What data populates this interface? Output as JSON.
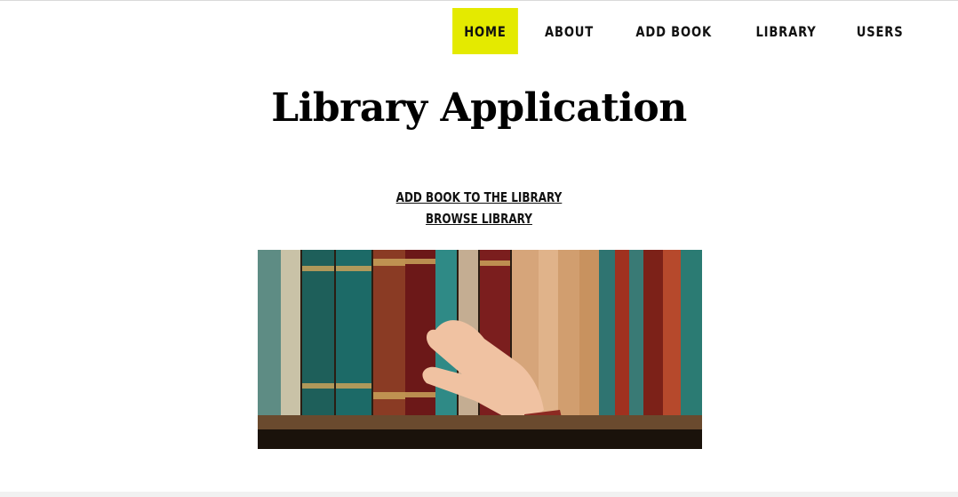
{
  "nav": {
    "items": [
      "HOME",
      "ABOUT",
      "ADD BOOK",
      "LIBRARY",
      "USERS"
    ],
    "active": "HOME",
    "accent_color": "#e4ea00"
  },
  "page": {
    "title": "Library Application"
  },
  "links": {
    "add_book": "ADD BOOK TO THE LIBRARY",
    "browse": "BROWSE LIBRARY"
  },
  "banner": {
    "description_icon": "bookshelf-photo"
  }
}
